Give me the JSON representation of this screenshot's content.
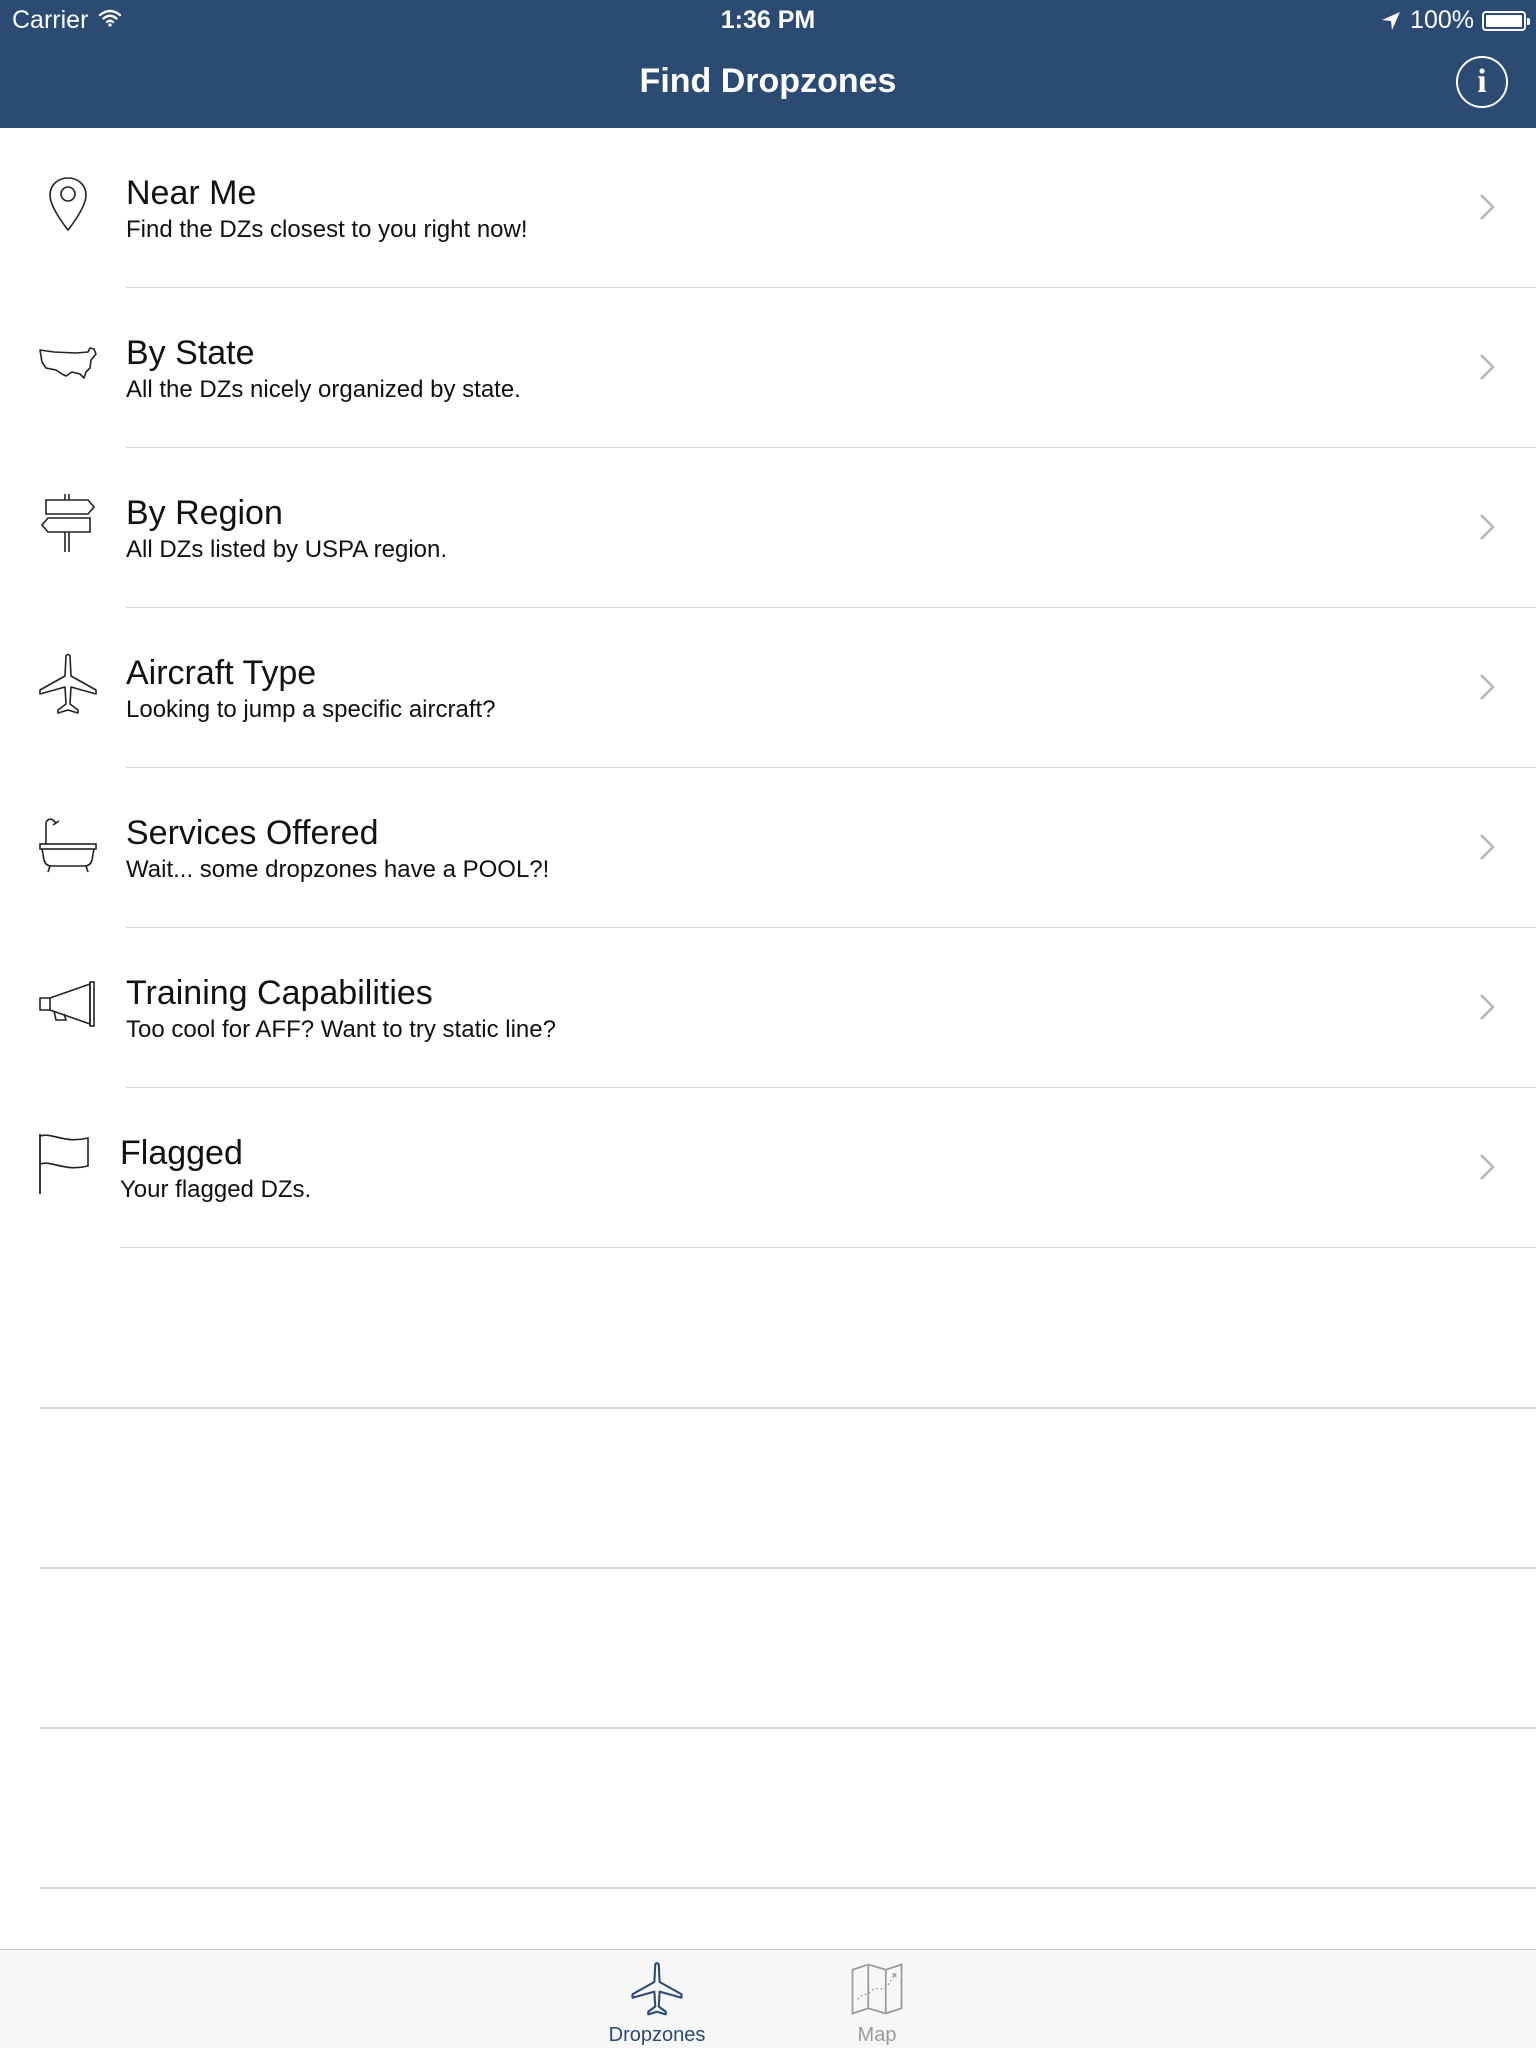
{
  "status_bar": {
    "carrier": "Carrier",
    "time": "1:36 PM",
    "battery": "100%"
  },
  "nav": {
    "title": "Find Dropzones",
    "info_icon": "info-icon"
  },
  "menu": [
    {
      "title": "Near Me",
      "subtitle": "Find the DZs closest to you right now!",
      "icon": "map-pin-icon"
    },
    {
      "title": "By State",
      "subtitle": "All the DZs nicely organized by state.",
      "icon": "usa-map-icon"
    },
    {
      "title": "By Region",
      "subtitle": "All DZs listed by USPA region.",
      "icon": "signpost-icon"
    },
    {
      "title": "Aircraft Type",
      "subtitle": "Looking to jump a specific aircraft?",
      "icon": "airplane-icon"
    },
    {
      "title": "Services Offered",
      "subtitle": "Wait... some dropzones have a POOL?!",
      "icon": "bathtub-icon"
    },
    {
      "title": "Training Capabilities",
      "subtitle": "Too cool for AFF? Want to try static line?",
      "icon": "megaphone-icon"
    },
    {
      "title": "Flagged",
      "subtitle": "Your flagged DZs.",
      "icon": "flag-icon"
    }
  ],
  "tabbar": {
    "tabs": [
      {
        "label": "Dropzones",
        "icon": "airplane-icon",
        "active": true
      },
      {
        "label": "Map",
        "icon": "folded-map-icon",
        "active": false
      }
    ]
  },
  "colors": {
    "nav_bg": "#2b4b72",
    "active_tab": "#2b4b72",
    "inactive_tab": "#9a9a9a",
    "separator": "#d6d6d6"
  }
}
